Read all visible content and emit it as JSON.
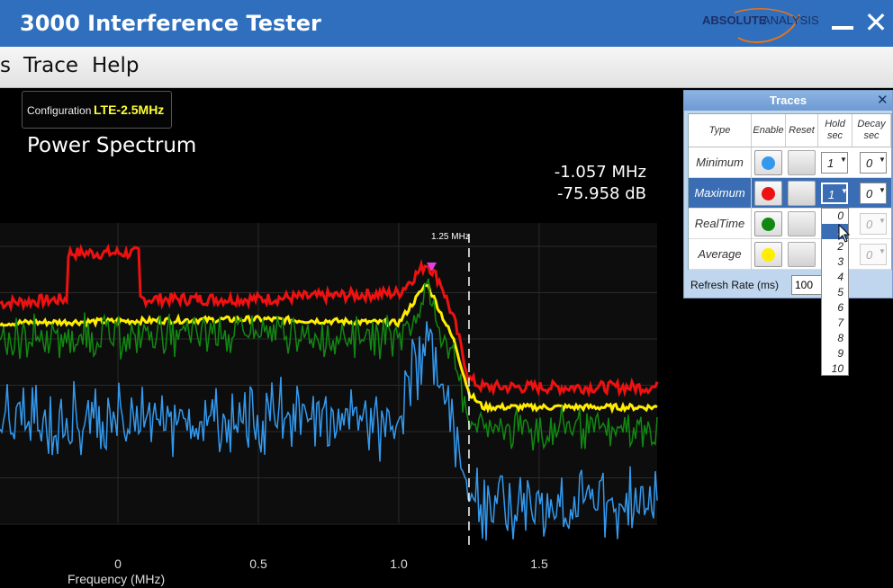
{
  "app": {
    "title": "3000 Interference Tester",
    "logo_text_1": "ABSOLUTE",
    "logo_text_2": "ANALYSIS"
  },
  "menu": {
    "items": [
      "s",
      "Trace",
      "Help"
    ]
  },
  "config": {
    "label": "Configuration",
    "value": "LTE-2.5MHz"
  },
  "spectrum": {
    "title": "Power Spectrum",
    "marker_freq": "-1.057 MHz",
    "marker_level": "-75.958 dB",
    "marker_line_label": "1.25 MHz",
    "xlabel": "Frequency (MHz)",
    "xticks": [
      "0",
      "0.5",
      "1.0",
      "1.5"
    ]
  },
  "traces_panel": {
    "title": "Traces",
    "headers": {
      "type": "Type",
      "enable": "Enable",
      "reset": "Reset",
      "hold": "Hold sec",
      "decay": "Decay sec"
    },
    "rows": [
      {
        "name": "Minimum",
        "color": "#3399ee",
        "hold": "1",
        "decay": "0"
      },
      {
        "name": "Maximum",
        "color": "#ee1111",
        "hold": "1",
        "decay": "0"
      },
      {
        "name": "RealTime",
        "color": "#118811",
        "hold": "",
        "decay": "0"
      },
      {
        "name": "Average",
        "color": "#ffee00",
        "hold": "",
        "decay": "0"
      }
    ],
    "refresh_label": "Refresh Rate (ms)",
    "refresh_value": "100",
    "hold_options": [
      "0",
      "1",
      "2",
      "3",
      "4",
      "5",
      "6",
      "7",
      "8",
      "9",
      "10"
    ],
    "hold_highlighted_index": 1
  },
  "colors": {
    "titlebar": "#2f6fbd",
    "min": "#3399ee",
    "max": "#ee1111",
    "realtime": "#118811",
    "average": "#ffee00"
  },
  "chart_data": {
    "type": "line",
    "xlabel": "Frequency (MHz)",
    "xlim": [
      -0.42,
      1.92
    ],
    "x_ticks": [
      0,
      0.5,
      1.0,
      1.5
    ],
    "marker_x": 1.25,
    "series": [
      {
        "color": "#ee1111",
        "x": [
          -0.42,
          -0.18,
          -0.18,
          0.08,
          0.08,
          0.5,
          1.0,
          1.1,
          1.15,
          1.2,
          1.25,
          1.3,
          1.92
        ],
        "y": [
          50,
          52,
          75,
          75,
          52,
          52,
          55,
          70,
          60,
          40,
          12,
          8,
          8
        ]
      },
      {
        "color": "#ffee00",
        "x": [
          -0.42,
          0.5,
          1.0,
          1.1,
          1.15,
          1.2,
          1.25,
          1.3,
          1.92
        ],
        "y": [
          40,
          42,
          40,
          60,
          45,
          30,
          5,
          -2,
          -2
        ]
      },
      {
        "color": "#118811",
        "x": [
          -0.42,
          0.5,
          1.0,
          1.1,
          1.15,
          1.2,
          1.25,
          1.3,
          1.92
        ],
        "y": [
          38,
          40,
          38,
          58,
          42,
          25,
          0,
          -8,
          -8
        ]
      },
      {
        "color": "#3399ee",
        "x": [
          -0.42,
          0.5,
          1.0,
          1.1,
          1.15,
          1.2,
          1.25,
          1.3,
          1.92
        ],
        "y": [
          0,
          2,
          0,
          45,
          20,
          -5,
          -30,
          -40,
          -40
        ]
      }
    ]
  }
}
